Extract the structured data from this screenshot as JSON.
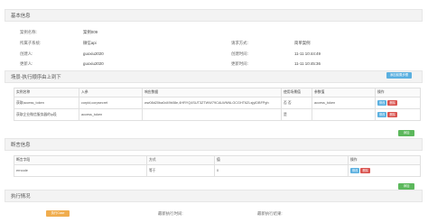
{
  "basic": {
    "title": "基本信息",
    "rows": [
      {
        "l1": "案例名称:",
        "v1": "案例009",
        "l2": "",
        "v2": ""
      },
      {
        "l1": "所属子系统:",
        "v1": "微信api",
        "l2": "请求方式:",
        "v2": "简单案例"
      },
      {
        "l1": "创建人:",
        "v1": "guoxiu2020",
        "l2": "创建时间:",
        "v2": "11-11 10:44:49"
      },
      {
        "l1": "更新人:",
        "v1": "guoxiu2020",
        "l2": "更新时间:",
        "v2": "11-11 10:45:36"
      }
    ]
  },
  "scene": {
    "title": "场景-执行顺序由上到下",
    "add_label": "添加前置步骤",
    "headers": [
      "实例名称",
      "入参",
      "响应数据",
      "使用场景值",
      "参数值",
      "操作"
    ],
    "rows": [
      {
        "name": "获取access_token",
        "param": "corpid,corpsecret",
        "resp": "ww08d20ba0d49b08e,4HRYQ4SUT3ZTWW79CALWNNLGCGHT6ZLsjyIDBFPgh",
        "scene": "否 否",
        "value": "access_token"
      },
      {
        "name": "获取企业微信服务器的ip段",
        "param": "access_token",
        "resp": "",
        "scene": "是",
        "value": ""
      }
    ],
    "edit_label": "修改",
    "delete_label": "删除"
  },
  "add_btn_1": "添加",
  "assert": {
    "title": "断言信息",
    "headers": [
      "断言字段",
      "方式",
      "值",
      "操作"
    ],
    "rows": [
      {
        "field": "errcode",
        "method": "等于",
        "value": "0"
      }
    ],
    "edit_label": "修改",
    "delete_label": "删除"
  },
  "add_btn_2": "添加",
  "execution": {
    "title": "执行情况",
    "run_label": "执行Case",
    "last_time_label": "最新执行时间:",
    "last_result_label": "最新执行结果:"
  },
  "colors": {
    "blue": "#5bb0e0",
    "red": "#d9534f",
    "green": "#5cb85c",
    "orange": "#f0ad4e"
  }
}
